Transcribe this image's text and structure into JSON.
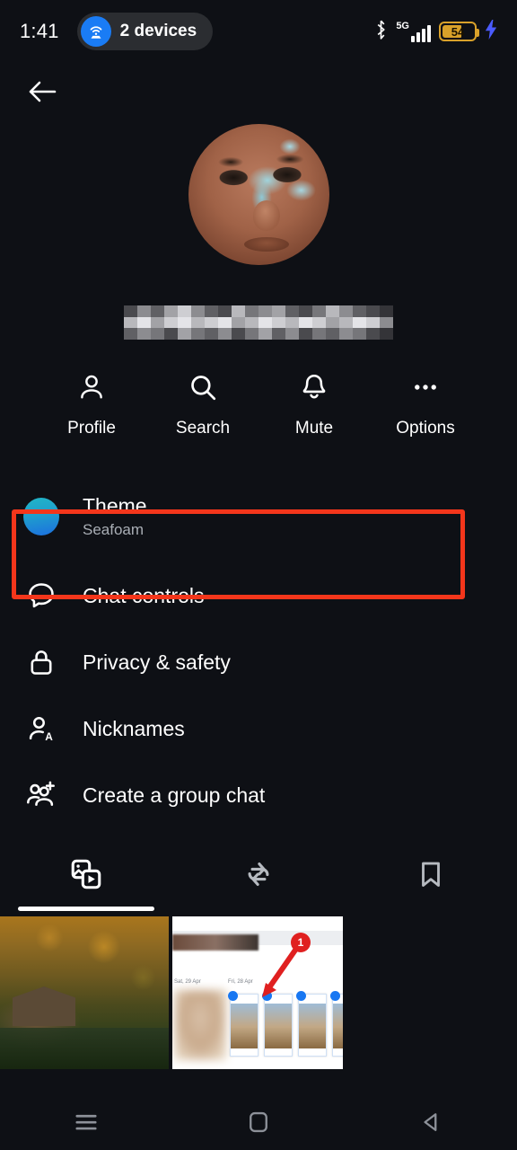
{
  "status_bar": {
    "time": "1:41",
    "devices_pill": {
      "label": "2 devices",
      "icon": "cast-router-icon",
      "accent": "#1a7cf5"
    },
    "bluetooth_icon": "bluetooth-icon",
    "network_label": "5G",
    "signal_icon": "signal-bars-icon",
    "battery": {
      "level": "54",
      "percent": 54,
      "charging": true,
      "color": "#d9a12a"
    },
    "charging_icon": "lightning-bolt-icon"
  },
  "header": {
    "back_icon": "arrow-left-icon"
  },
  "profile": {
    "avatar_alt": "contact-profile-photo",
    "name_censored": true,
    "name_label": ""
  },
  "actions": [
    {
      "label": "Profile",
      "icon": "person-icon"
    },
    {
      "label": "Search",
      "icon": "magnifier-icon"
    },
    {
      "label": "Mute",
      "icon": "bell-icon"
    },
    {
      "label": "Options",
      "icon": "ellipsis-icon"
    }
  ],
  "menu": [
    {
      "title": "Theme",
      "subtitle": "Seafoam",
      "icon": "theme-color-circle",
      "highlighted": true,
      "swatch_from": "#21b6c7",
      "swatch_to": "#1c6fe0"
    },
    {
      "title": "Chat controls",
      "subtitle": "",
      "icon": "chat-bubble-icon",
      "highlighted": false
    },
    {
      "title": "Privacy & safety",
      "subtitle": "",
      "icon": "lock-icon",
      "highlighted": false
    },
    {
      "title": "Nicknames",
      "subtitle": "",
      "icon": "person-a-icon",
      "highlighted": false
    },
    {
      "title": "Create a group chat",
      "subtitle": "",
      "icon": "add-people-icon",
      "highlighted": false
    }
  ],
  "highlight": {
    "color": "#f4361b",
    "target": "Theme"
  },
  "tabs": [
    {
      "icon": "media-photos-videos-icon",
      "active": true
    },
    {
      "icon": "shared-repeat-icon",
      "active": false
    },
    {
      "icon": "bookmark-icon",
      "active": false
    }
  ],
  "media_items": [
    {
      "name": "autumn-cabin-lake-photo",
      "type": "photo"
    },
    {
      "name": "annotated-screenshot",
      "type": "screenshot",
      "annotation_badge": "1",
      "label_left": "Sat, 29 Apr",
      "label_right": "Fri, 28 Apr"
    }
  ],
  "navbar": [
    {
      "icon": "recents-icon"
    },
    {
      "icon": "home-square-icon"
    },
    {
      "icon": "back-triangle-icon"
    }
  ]
}
